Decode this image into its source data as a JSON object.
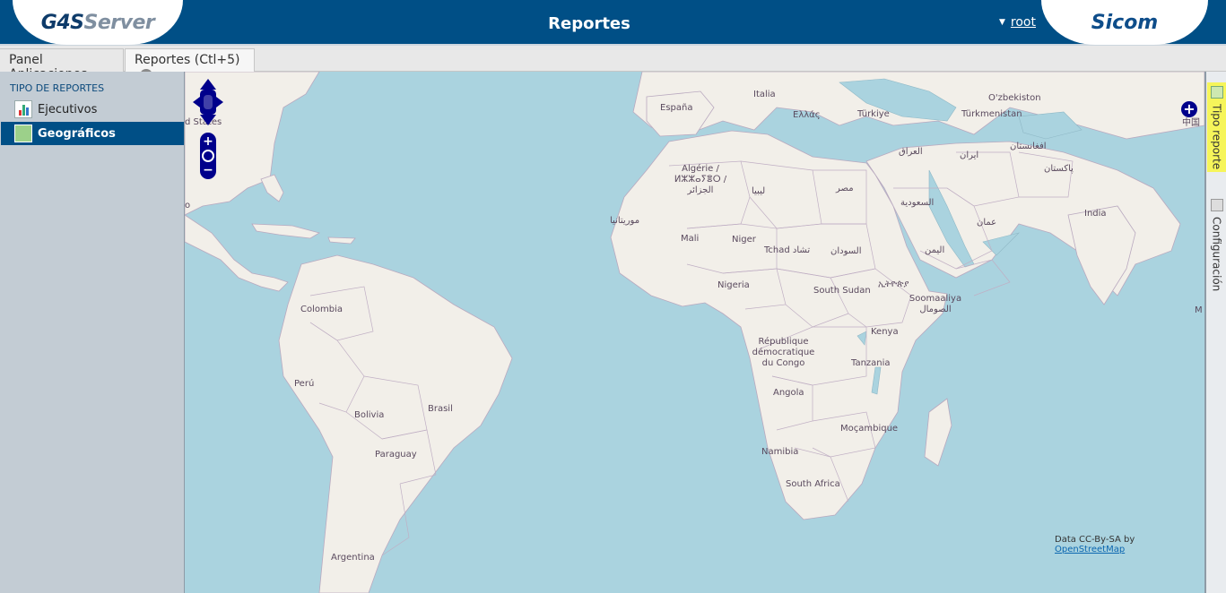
{
  "header": {
    "logo_left": {
      "part1": "G4S",
      "part2": "Server"
    },
    "title": "Reportes",
    "user": "root",
    "logo_right": "Sicom"
  },
  "tabs": [
    {
      "label": "Panel Aplicaciones"
    },
    {
      "label": "Reportes (Ctl+5)",
      "close": "×"
    }
  ],
  "sidebar": {
    "heading": "TIPO DE REPORTES",
    "items": [
      {
        "label": "Ejecutivos",
        "selected": false
      },
      {
        "label": "Geográficos",
        "selected": true
      }
    ]
  },
  "map": {
    "labels": {
      "italia": "Italia",
      "espana": "España",
      "ellas": "Ελλάς",
      "turkiye": "Türkiye",
      "uzbekistan": "O'zbekiston",
      "turkmenistan": "Türkmenistan",
      "algerie": "Algérie / ⵍⵣⵣⴰⵢⴻⵔ / الجزائر",
      "libya": "ليبيا",
      "misr": "مصر",
      "iraq": "العراق",
      "iran": "ایران",
      "afghanistan": "افغانستان",
      "pakistan": "پاکستان",
      "saudi": "السعودية",
      "oman": "عمان",
      "india": "India",
      "mauritania": "موريتانيا",
      "mali": "Mali",
      "niger": "Niger",
      "tchad": "Tchad تشاد",
      "sudan": "السودان",
      "yemen": "اليمن",
      "nigeria": "Nigeria",
      "south_sudan": "South Sudan",
      "ethiopia": "ኢትዮጵያ",
      "somalia": "Soomaaliya الصومال",
      "colombia": "Colombia",
      "rdc": "République démocratique du Congo",
      "kenya": "Kenya",
      "tanzania": "Tanzania",
      "peru": "Perú",
      "bolivia": "Bolivia",
      "brasil": "Brasil",
      "angola": "Angola",
      "mocambique": "Moçambique",
      "paraguay": "Paraguay",
      "namibia": "Namibia",
      "south_africa": "South Africa",
      "argentina": "Argentina",
      "united_states": "d States",
      "zhongguo": "中国",
      "edge_o": "o",
      "edge_m": "M"
    },
    "attribution_text": "Data CC-By-SA by",
    "attribution_link": "OpenStreetMap",
    "zoom_in": "+",
    "zoom_out": "−",
    "layer_switch": "+"
  },
  "right_panel": {
    "tabs": [
      {
        "label": "Tipo reporte",
        "active": true
      },
      {
        "label": "Configuración",
        "active": false
      }
    ]
  },
  "colors": {
    "header_bg": "#004f86",
    "sea": "#aad3df",
    "land": "#f2efe9",
    "selected_bg": "#004f86",
    "active_panel_tab": "#f6f55a"
  }
}
